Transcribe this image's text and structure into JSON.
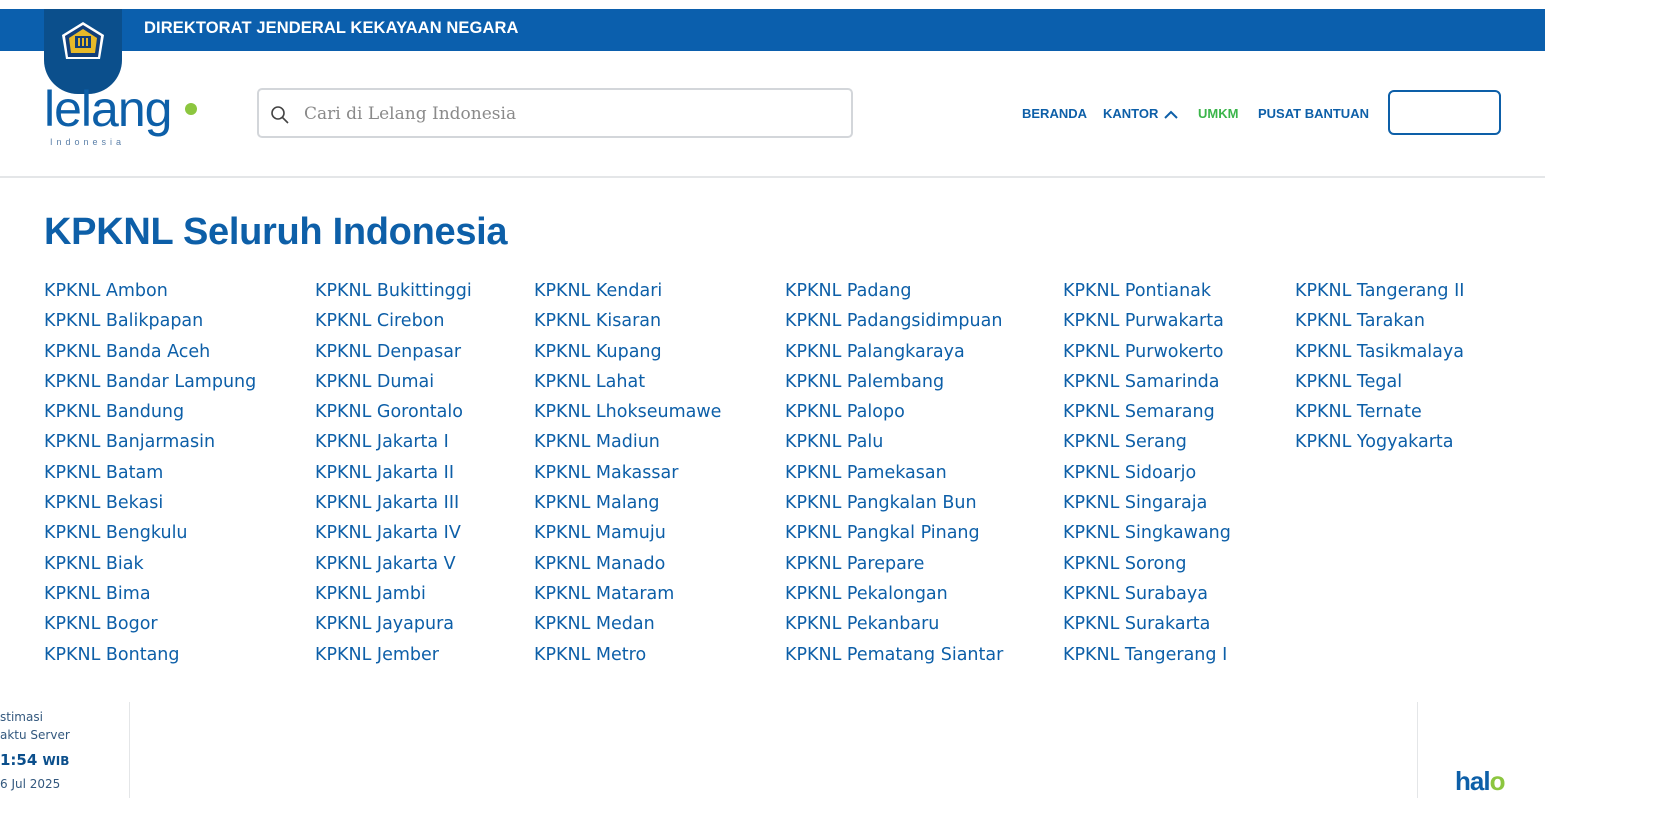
{
  "topbar": {
    "title": "DIREKTORAT JENDERAL KEKAYAAN NEGARA"
  },
  "logo": {
    "word": "lelang",
    "sub": "Indonesia"
  },
  "search": {
    "placeholder": "Cari di Lelang Indonesia"
  },
  "nav": {
    "beranda": "BERANDA",
    "kantor": "KANTOR",
    "umkm": "UMKM",
    "pusat_bantuan": "PUSAT BANTUAN",
    "login_label": ""
  },
  "colors": {
    "primary": "#0b5fad",
    "accent_green": "#3bb54a",
    "logo_green": "#8cc63f"
  },
  "main": {
    "title": "KPKNL Seluruh Indonesia",
    "columns": [
      [
        "KPKNL Ambon",
        "KPKNL Balikpapan",
        "KPKNL Banda Aceh",
        "KPKNL Bandar Lampung",
        "KPKNL Bandung",
        "KPKNL Banjarmasin",
        "KPKNL Batam",
        "KPKNL Bekasi",
        "KPKNL Bengkulu",
        "KPKNL Biak",
        "KPKNL Bima",
        "KPKNL Bogor",
        "KPKNL Bontang"
      ],
      [
        "KPKNL Bukittinggi",
        "KPKNL Cirebon",
        "KPKNL Denpasar",
        "KPKNL Dumai",
        "KPKNL Gorontalo",
        "KPKNL Jakarta I",
        "KPKNL Jakarta II",
        "KPKNL Jakarta III",
        "KPKNL Jakarta IV",
        "KPKNL Jakarta V",
        "KPKNL Jambi",
        "KPKNL Jayapura",
        "KPKNL Jember"
      ],
      [
        "KPKNL Kendari",
        "KPKNL Kisaran",
        "KPKNL Kupang",
        "KPKNL Lahat",
        "KPKNL Lhokseumawe",
        "KPKNL Madiun",
        "KPKNL Makassar",
        "KPKNL Malang",
        "KPKNL Mamuju",
        "KPKNL Manado",
        "KPKNL Mataram",
        "KPKNL Medan",
        "KPKNL Metro"
      ],
      [
        "KPKNL Padang",
        "KPKNL Padangsidimpuan",
        "KPKNL Palangkaraya",
        "KPKNL Palembang",
        "KPKNL Palopo",
        "KPKNL Palu",
        "KPKNL Pamekasan",
        "KPKNL Pangkalan Bun",
        "KPKNL Pangkal Pinang",
        "KPKNL Parepare",
        "KPKNL Pekalongan",
        "KPKNL Pekanbaru",
        "KPKNL Pematang Siantar"
      ],
      [
        "KPKNL Pontianak",
        "KPKNL Purwakarta",
        "KPKNL Purwokerto",
        "KPKNL Samarinda",
        "KPKNL Semarang",
        "KPKNL Serang",
        "KPKNL Sidoarjo",
        "KPKNL Singaraja",
        "KPKNL Singkawang",
        "KPKNL Sorong",
        "KPKNL Surabaya",
        "KPKNL Surakarta",
        "KPKNL Tangerang I"
      ],
      [
        "KPKNL Tangerang II",
        "KPKNL Tarakan",
        "KPKNL Tasikmalaya",
        "KPKNL Tegal",
        "KPKNL Ternate",
        "KPKNL Yogyakarta"
      ]
    ]
  },
  "footer": {
    "est_line1": "stimasi",
    "est_line2": "aktu Server",
    "time": "1:54",
    "tz": "WIB",
    "date": "6 Jul 2025",
    "halo_prefix": "hal",
    "halo_o": "o"
  }
}
